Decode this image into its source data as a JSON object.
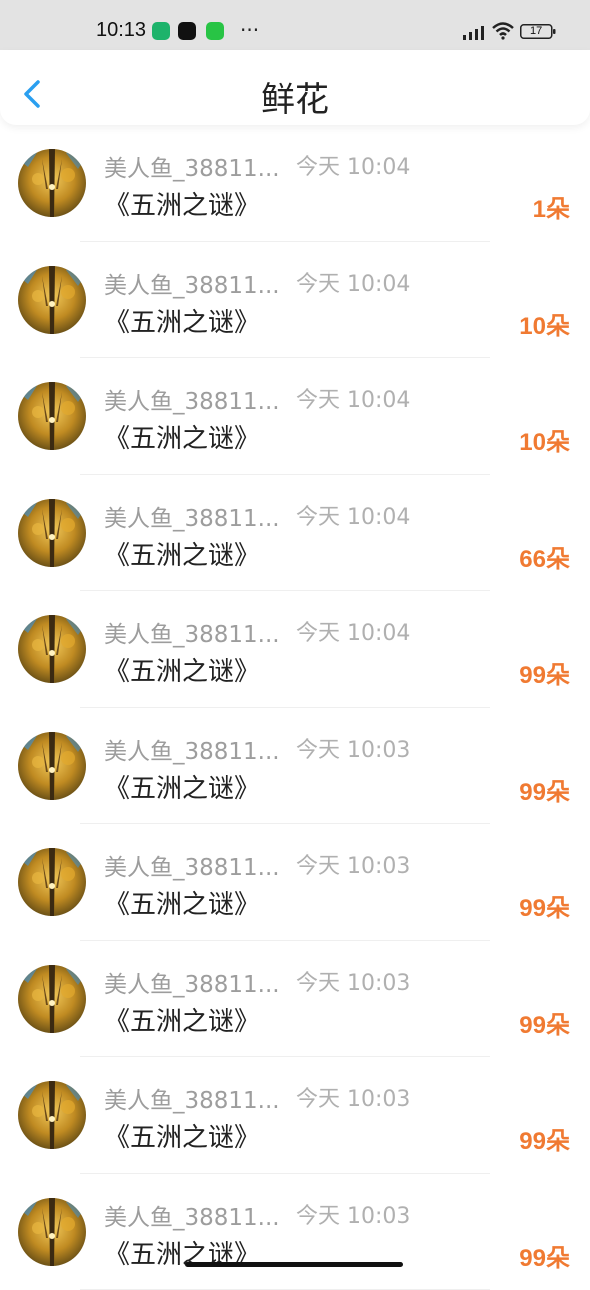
{
  "status_bar": {
    "time": "10:13",
    "more": "···",
    "battery": "17"
  },
  "header": {
    "back_icon": "chevron-left-icon",
    "title": "鲜花"
  },
  "colors": {
    "accent": "#2a9ff0",
    "count": "#f07a32",
    "name": "#9d9d9d"
  },
  "items": [
    {
      "name": "美人鱼_38811...",
      "time": "今天 10:04",
      "book": "《五洲之谜》",
      "count": "1朵"
    },
    {
      "name": "美人鱼_38811...",
      "time": "今天 10:04",
      "book": "《五洲之谜》",
      "count": "10朵"
    },
    {
      "name": "美人鱼_38811...",
      "time": "今天 10:04",
      "book": "《五洲之谜》",
      "count": "10朵"
    },
    {
      "name": "美人鱼_38811...",
      "time": "今天 10:04",
      "book": "《五洲之谜》",
      "count": "66朵"
    },
    {
      "name": "美人鱼_38811...",
      "time": "今天 10:04",
      "book": "《五洲之谜》",
      "count": "99朵"
    },
    {
      "name": "美人鱼_38811...",
      "time": "今天 10:03",
      "book": "《五洲之谜》",
      "count": "99朵"
    },
    {
      "name": "美人鱼_38811...",
      "time": "今天 10:03",
      "book": "《五洲之谜》",
      "count": "99朵"
    },
    {
      "name": "美人鱼_38811...",
      "time": "今天 10:03",
      "book": "《五洲之谜》",
      "count": "99朵"
    },
    {
      "name": "美人鱼_38811...",
      "time": "今天 10:03",
      "book": "《五洲之谜》",
      "count": "99朵"
    },
    {
      "name": "美人鱼_38811...",
      "time": "今天 10:03",
      "book": "《五洲之谜》",
      "count": "99朵"
    }
  ]
}
